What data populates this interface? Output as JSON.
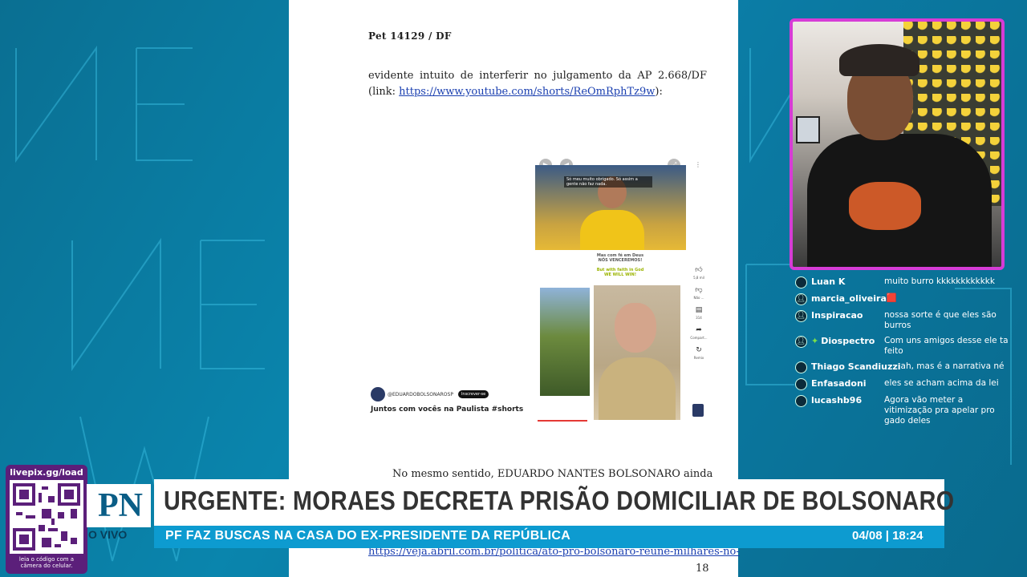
{
  "document": {
    "header": "Pet 14129 / DF",
    "paragraph_text": "evidente intuito de interferir no julgamento da AP 2.668/DF (link: ",
    "paragraph_link": "https://www.youtube.com/shorts/ReOmRphTz9w",
    "paragraph_end": "):",
    "paragraph2": "No mesmo sentido, EDUARDO NANTES BOLSONARO ainda",
    "link2": "https://veja.abril.com.br/politica/ato-pro-bolsonaro-reune-milhares-no-",
    "page_number": "18"
  },
  "short": {
    "caption": "Só meu muito obrigado. Só assim a gente não faz nada.",
    "line1": "Mas com fé em Deus",
    "line2": "NÓS VENCEREMOS!",
    "line3": "But with faith in God",
    "line4": "WE WILL WIN!",
    "likes": "5,8 mil",
    "dislike_label": "Não ...",
    "comments": "314",
    "share_label": "Compart...",
    "remix_label": "Remix",
    "channel": "@EDUARDOBOLSONAROSP",
    "subscribe": "Inscrever-se",
    "title": "Juntos com vocês na Paulista #shorts"
  },
  "chat": [
    {
      "user": "Luan K",
      "msg": "muito burro kkkkkkkkkkkk",
      "icon": "avatar-icon"
    },
    {
      "user": "marcia_oliveira",
      "msg": "🟥",
      "icon": "person-icon"
    },
    {
      "user": "Inspiracao",
      "msg": "nossa sorte é que eles são burros",
      "icon": "person-icon"
    },
    {
      "user": "Diospectro",
      "msg": "Com uns amigos desse ele ta feito",
      "icon": "person-icon",
      "badge": "diamond-icon"
    },
    {
      "user": "Thiago Scandiuzzi",
      "msg": "ah, mas é a narrativa né",
      "icon": "avatar-icon"
    },
    {
      "user": "Enfasadoni",
      "msg": "eles se acham acima da lei",
      "icon": "avatar-icon"
    },
    {
      "user": "lucashb96",
      "msg": "Agora vão meter a vitimização pra apelar pro gado deles",
      "icon": "avatar-icon"
    }
  ],
  "lower_third": {
    "qr_url": "livepix.gg/load",
    "qr_note": "leia o código com a câmera do celular.",
    "logo": "PN",
    "live": "O VIVO",
    "headline": "URGENTE: MORAES DECRETA PRISÃO DOMICILIAR DE BOLSONARO",
    "subheadline": "PF FAZ BUSCAS NA CASA DO EX-PRESIDENTE DA REPÚBLICA",
    "datetime": "04/08 | 18:24"
  },
  "colors": {
    "background": "#0a85ad",
    "cam_border": "#d63cd6",
    "headline_bar": "#ffffff",
    "sub_bar": "#0d9bd0",
    "qr_box": "#5b1f7a"
  }
}
